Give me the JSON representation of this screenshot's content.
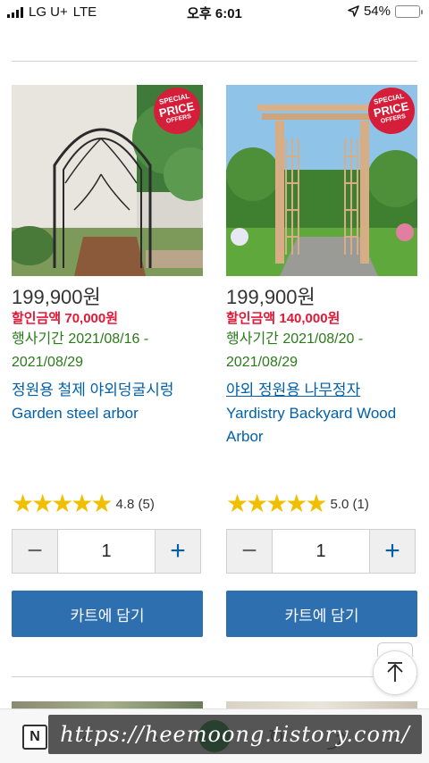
{
  "status_bar": {
    "carrier": "LG U+",
    "network": "LTE",
    "time": "오후 6:01",
    "battery": "54%",
    "battery_level": 0.54
  },
  "products": [
    {
      "price": "199,900원",
      "discount": "할인금액 70,000원",
      "period_line1": "행사기간 2021/08/16 -",
      "period_line2": "2021/08/29",
      "name_ko": "정원용 철제 야외덩굴시렁",
      "name_en": "Garden steel arbor",
      "stars": "★★★★★",
      "rating": "4.8 (5)",
      "rating_value": 4.8,
      "quantity": "1",
      "cart_label": "카트에 담기",
      "badge": [
        "SPECIAL",
        "PRICE",
        "OFFERS"
      ]
    },
    {
      "price": "199,900원",
      "discount": "할인금액 140,000원",
      "period_line1": "행사기간 2021/08/20 -",
      "period_line2": "2021/08/29",
      "name_ko": "야외 정원용 나무정자",
      "name_en": "Yardistry Backyard Wood Arbor",
      "stars": "★★★★★",
      "rating": "5.0 (1)",
      "rating_value": 5.0,
      "quantity": "1",
      "cart_label": "카트에 담기",
      "badge": [
        "SPECIAL",
        "PRICE",
        "OFFERS"
      ]
    }
  ],
  "browser": {
    "n_label": "N",
    "watermark": "https://heemoong.tistory.com/"
  },
  "colors": {
    "price_red": "#e31837",
    "period_green": "#2a7a1a",
    "link_blue": "#0060a9",
    "cart_blue": "#2e6fb0",
    "star_gold": "#f0c000",
    "badge_red": "#d51f3a"
  },
  "icons": {
    "location": "location-arrow-icon",
    "battery": "battery-icon",
    "scroll_top": "arrow-up-icon",
    "minus": "minus-icon",
    "plus": "plus-icon"
  }
}
